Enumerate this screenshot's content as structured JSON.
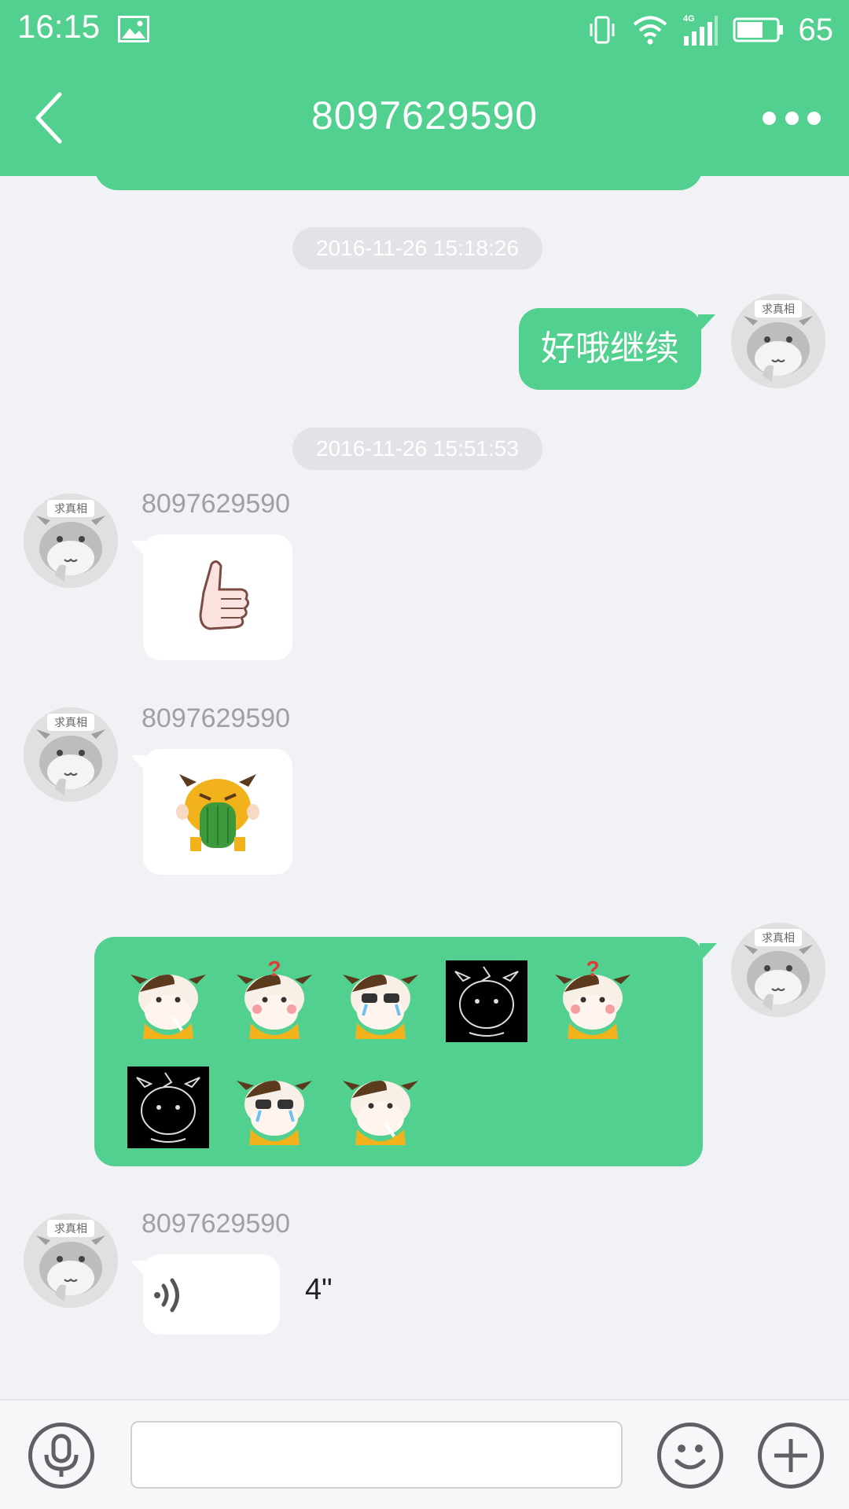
{
  "status_bar": {
    "time": "16:15",
    "battery": "65",
    "icons": [
      "gallery-icon",
      "vibrate-icon",
      "wifi-icon",
      "4g-signal-icon",
      "battery-icon"
    ]
  },
  "header": {
    "title": "8097629590",
    "back_icon": "back-chevron-icon",
    "more_icon": "more-dots-icon"
  },
  "avatar_badge": "求真相",
  "messages": [
    {
      "kind": "timestamp",
      "text": "2016-11-26 15:18:26"
    },
    {
      "kind": "outgoing-text",
      "text": "好哦继续"
    },
    {
      "kind": "timestamp",
      "text": "2016-11-26 15:51:53"
    },
    {
      "kind": "incoming-sticker",
      "sender": "8097629590",
      "sticker": "thumbs-up-sticker"
    },
    {
      "kind": "incoming-sticker",
      "sender": "8097629590",
      "sticker": "cow-vomit-sticker"
    },
    {
      "kind": "outgoing-stickers",
      "stickers": [
        "cow-smoking-sticker",
        "cow-question-sticker",
        "cow-crying-sunglasses-sticker",
        "cow-dark-sticker",
        "cow-question-sticker",
        "cow-dark-sticker",
        "cow-crying-sunglasses-sticker",
        "cow-smoking-sticker"
      ]
    },
    {
      "kind": "incoming-voice",
      "sender": "8097629590",
      "duration": "4\""
    }
  ],
  "input_bar": {
    "mic_icon": "microphone-icon",
    "input_value": "",
    "input_placeholder": "",
    "emoji_icon": "smiley-icon",
    "plus_icon": "plus-icon"
  },
  "colors": {
    "accent": "#52d08f",
    "background": "#f1f2f6",
    "timestamp_bg": "#e2e3e7"
  }
}
